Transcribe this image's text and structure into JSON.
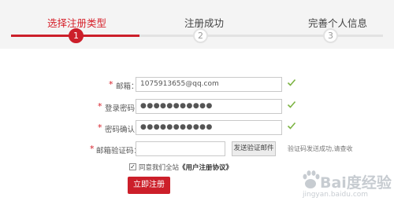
{
  "steps": [
    {
      "number": "1",
      "label": "选择注册类型",
      "active": true
    },
    {
      "number": "2",
      "label": "注册成功",
      "active": false
    },
    {
      "number": "3",
      "label": "完善个人信息",
      "active": false
    }
  ],
  "form": {
    "required_mark": "*",
    "email": {
      "label": "邮箱：",
      "value": "1075913655@qq.com",
      "valid": true
    },
    "password": {
      "label": "登录密码：",
      "value": "●●●●●●●●●●●",
      "valid": true
    },
    "confirm": {
      "label": "密码确认：",
      "value": "●●●●●●●●●●●",
      "valid": true
    },
    "code": {
      "label": "邮箱验证码：",
      "value": "",
      "button": "发送验证邮件",
      "hint": "验证码发送成功,请查收"
    }
  },
  "agreement": {
    "checked": true,
    "check_glyph": "✓",
    "text": "同意我们全站",
    "link": "《用户注册协议》"
  },
  "submit_label": "立即注册",
  "colors": {
    "accent": "#cc1f2a",
    "check": "#7cb342",
    "track": "#e2e2e2",
    "header_bg": "#f4f4f4"
  },
  "watermark": {
    "text": "Bai度经验",
    "url": "jingyan.baidu.com"
  }
}
